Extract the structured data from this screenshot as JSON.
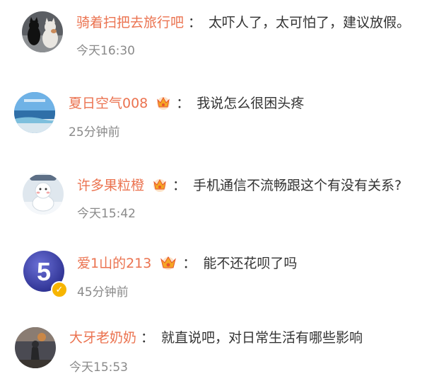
{
  "comments": [
    {
      "username": "骑着扫把去旅行吧",
      "colon": "：",
      "text": "太吓人了，太可怕了，建议放假。",
      "time": "今天16:30",
      "member": false,
      "verified": false
    },
    {
      "username": "夏日空气008",
      "colon": "：",
      "text": "我说怎么很困头疼",
      "time": "25分钟前",
      "member": true,
      "verified": false
    },
    {
      "username": "许多果粒橙",
      "colon": "：",
      "text": "手机通信不流畅跟这个有没有关系?",
      "time": "今天15:42",
      "member": true,
      "verified": false
    },
    {
      "username": "爱1山的213",
      "colon": "：",
      "text": "能不还花呗了吗",
      "time": "45分钟前",
      "member": true,
      "verified": true,
      "avatar_label": "5"
    },
    {
      "username": "大牙老奶奶",
      "colon": "：",
      "text": "就直说吧，对日常生活有哪些影响",
      "time": "今天15:53",
      "member": false,
      "verified": false
    }
  ],
  "colors": {
    "username": "#eb7350",
    "text": "#333333",
    "time": "#8a8a8a",
    "crown": "#f5a623",
    "verified": "#f7b500"
  },
  "icons": {
    "member": "crown-icon",
    "verified": "verified-badge-icon"
  }
}
